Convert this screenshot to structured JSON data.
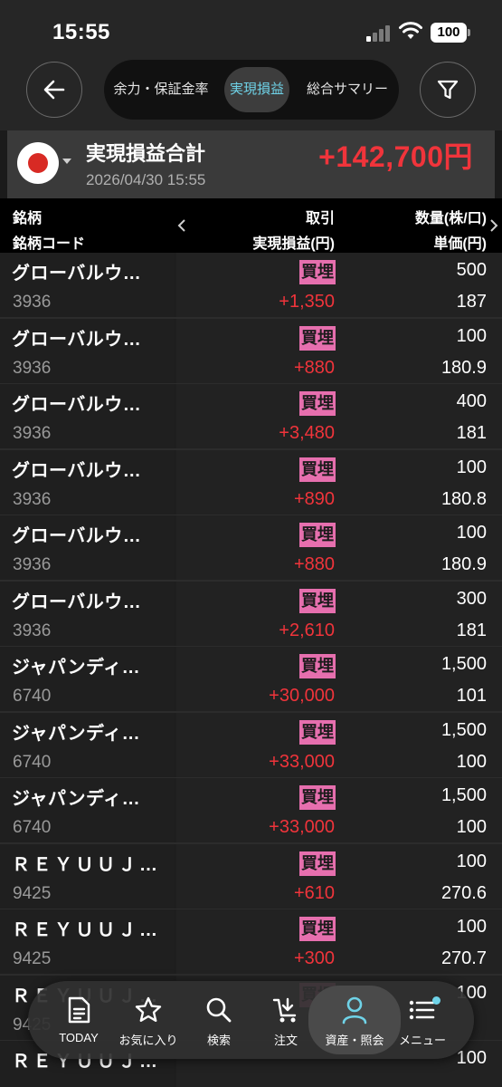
{
  "status_bar": {
    "time": "15:55",
    "battery": "100"
  },
  "header": {
    "tabs": [
      {
        "label": "余力・保証金率",
        "active": false
      },
      {
        "label": "実現損益",
        "active": true
      },
      {
        "label": "総合サマリー",
        "active": false
      }
    ],
    "back_icon": "arrow-left-icon",
    "filter_icon": "funnel-icon"
  },
  "summary": {
    "title": "実現損益合計",
    "date": "2026/04/30 15:55",
    "total": "+142,700円",
    "market_icon": "japan-flag-icon"
  },
  "columns": {
    "stock": "銘柄",
    "stock_code": "銘柄コード",
    "trade": "取引",
    "realized_pnl": "実現損益(円)",
    "quantity": "数量(株/口)",
    "unit_price": "単価(円)"
  },
  "rows": [
    {
      "name": "グローバルウ…",
      "code": "3936",
      "trade": "買埋",
      "pnl": "+1,350",
      "qty": "500",
      "price": "187"
    },
    {
      "name": "グローバルウ…",
      "code": "3936",
      "trade": "買埋",
      "pnl": "+880",
      "qty": "100",
      "price": "180.9"
    },
    {
      "name": "グローバルウ…",
      "code": "3936",
      "trade": "買埋",
      "pnl": "+3,480",
      "qty": "400",
      "price": "181"
    },
    {
      "name": "グローバルウ…",
      "code": "3936",
      "trade": "買埋",
      "pnl": "+890",
      "qty": "100",
      "price": "180.8"
    },
    {
      "name": "グローバルウ…",
      "code": "3936",
      "trade": "買埋",
      "pnl": "+880",
      "qty": "100",
      "price": "180.9"
    },
    {
      "name": "グローバルウ…",
      "code": "3936",
      "trade": "買埋",
      "pnl": "+2,610",
      "qty": "300",
      "price": "181"
    },
    {
      "name": "ジャパンディ…",
      "code": "6740",
      "trade": "買埋",
      "pnl": "+30,000",
      "qty": "1,500",
      "price": "101"
    },
    {
      "name": "ジャパンディ…",
      "code": "6740",
      "trade": "買埋",
      "pnl": "+33,000",
      "qty": "1,500",
      "price": "100"
    },
    {
      "name": "ジャパンディ…",
      "code": "6740",
      "trade": "買埋",
      "pnl": "+33,000",
      "qty": "1,500",
      "price": "100"
    },
    {
      "name": "ＲＥＹＵＵＪ…",
      "code": "9425",
      "trade": "買埋",
      "pnl": "+610",
      "qty": "100",
      "price": "270.6"
    },
    {
      "name": "ＲＥＹＵＵＪ…",
      "code": "9425",
      "trade": "買埋",
      "pnl": "+300",
      "qty": "100",
      "price": "270.7"
    },
    {
      "name": "ＲＥＹＵＵＪ…",
      "code": "9425",
      "trade": "買埋",
      "pnl": "",
      "qty": "100",
      "price": ""
    },
    {
      "name": "ＲＥＹＵＵＪ…",
      "code": "",
      "trade": "",
      "pnl": "",
      "qty": "100",
      "price": ""
    }
  ],
  "tab_bar": [
    {
      "label": "TODAY",
      "icon": "document-icon"
    },
    {
      "label": "お気に入り",
      "icon": "star-icon"
    },
    {
      "label": "検索",
      "icon": "search-icon"
    },
    {
      "label": "注文",
      "icon": "cart-icon"
    },
    {
      "label": "資産・照会",
      "icon": "person-icon",
      "active": true
    },
    {
      "label": "メニュー",
      "icon": "menu-list-icon"
    }
  ],
  "colors": {
    "accent": "#6fd3e8",
    "profit": "#f0343b",
    "badge": "#e66fae"
  }
}
